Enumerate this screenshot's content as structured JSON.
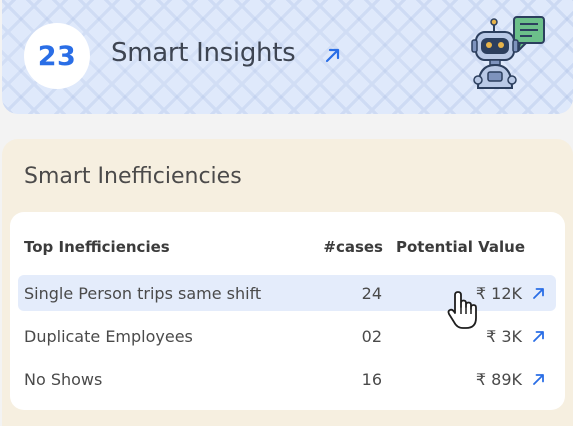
{
  "insights": {
    "count": "23",
    "title": "Smart Insights",
    "arrow_icon": "arrow-up-right-icon",
    "robot_icon": "robot-chat-icon"
  },
  "inefficiencies": {
    "title": "Smart Inefficiencies",
    "columns": {
      "name": "Top Inefficiencies",
      "cases": "#cases",
      "value": "Potential Value"
    },
    "rows": [
      {
        "name": "Single Person trips same shift",
        "cases": "24",
        "value": "₹ 12K"
      },
      {
        "name": "Duplicate Employees",
        "cases": "02",
        "value": "₹ 3K"
      },
      {
        "name": "No Shows",
        "cases": "16",
        "value": "₹ 89K"
      }
    ]
  },
  "colors": {
    "accent": "#2a6ee6",
    "insights_bg": "#dfe9fb",
    "ineff_bg": "#f6efe0",
    "row_highlight": "#e4ecfb"
  }
}
